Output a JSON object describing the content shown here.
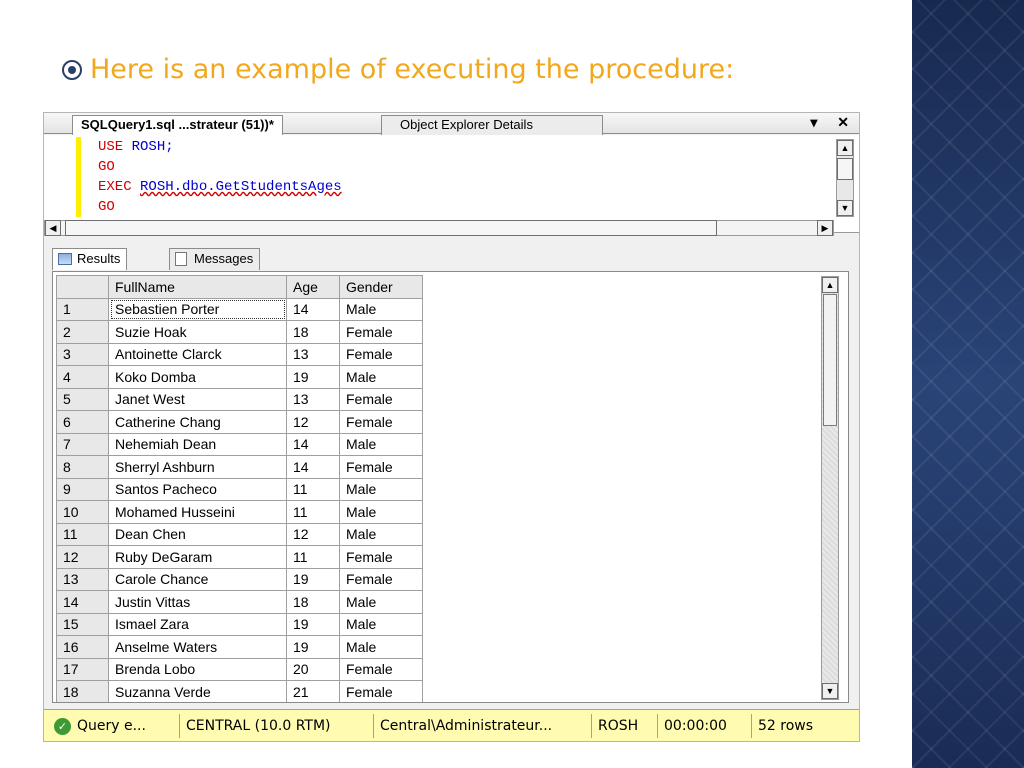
{
  "slide": {
    "bullet_text": "Here is an example of executing the procedure:"
  },
  "editor_tabs": {
    "active": "SQLQuery1.sql ...strateur (51))*",
    "inactive": "Object Explorer Details",
    "dropdown_glyph": "▾",
    "close_glyph": "✕"
  },
  "code": {
    "line1_kw": "USE",
    "line1_id": "ROSH;",
    "line2": "GO",
    "line3_kw": "EXEC",
    "line3_id": "ROSH.dbo.GetStudentsAges",
    "line4": "GO"
  },
  "result_tabs": {
    "results": "Results",
    "messages": "Messages"
  },
  "grid": {
    "columns": [
      "FullName",
      "Age",
      "Gender"
    ],
    "rows": [
      [
        "1",
        "Sebastien Porter",
        "14",
        "Male"
      ],
      [
        "2",
        "Suzie Hoak",
        "18",
        "Female"
      ],
      [
        "3",
        "Antoinette Clarck",
        "13",
        "Female"
      ],
      [
        "4",
        "Koko Domba",
        "19",
        "Male"
      ],
      [
        "5",
        "Janet West",
        "13",
        "Female"
      ],
      [
        "6",
        "Catherine Chang",
        "12",
        "Female"
      ],
      [
        "7",
        "Nehemiah Dean",
        "14",
        "Male"
      ],
      [
        "8",
        "Sherryl Ashburn",
        "14",
        "Female"
      ],
      [
        "9",
        "Santos Pacheco",
        "11",
        "Male"
      ],
      [
        "10",
        "Mohamed Husseini",
        "11",
        "Male"
      ],
      [
        "11",
        "Dean Chen",
        "12",
        "Male"
      ],
      [
        "12",
        "Ruby DeGaram",
        "11",
        "Female"
      ],
      [
        "13",
        "Carole Chance",
        "19",
        "Female"
      ],
      [
        "14",
        "Justin Vittas",
        "18",
        "Male"
      ],
      [
        "15",
        "Ismael Zara",
        "19",
        "Male"
      ],
      [
        "16",
        "Anselme Waters",
        "19",
        "Male"
      ],
      [
        "17",
        "Brenda Lobo",
        "20",
        "Female"
      ],
      [
        "18",
        "Suzanna Verde",
        "21",
        "Female"
      ]
    ]
  },
  "status": {
    "query": "Query e...",
    "server": "CENTRAL (10.0 RTM)",
    "user": "Central\\Administrateur...",
    "database": "ROSH",
    "elapsed": "00:00:00",
    "rows": "52 rows"
  },
  "colors": {
    "bullet_text": "#f2a81d",
    "status_bg": "#fffbb0",
    "side_band": "#1f3563"
  }
}
